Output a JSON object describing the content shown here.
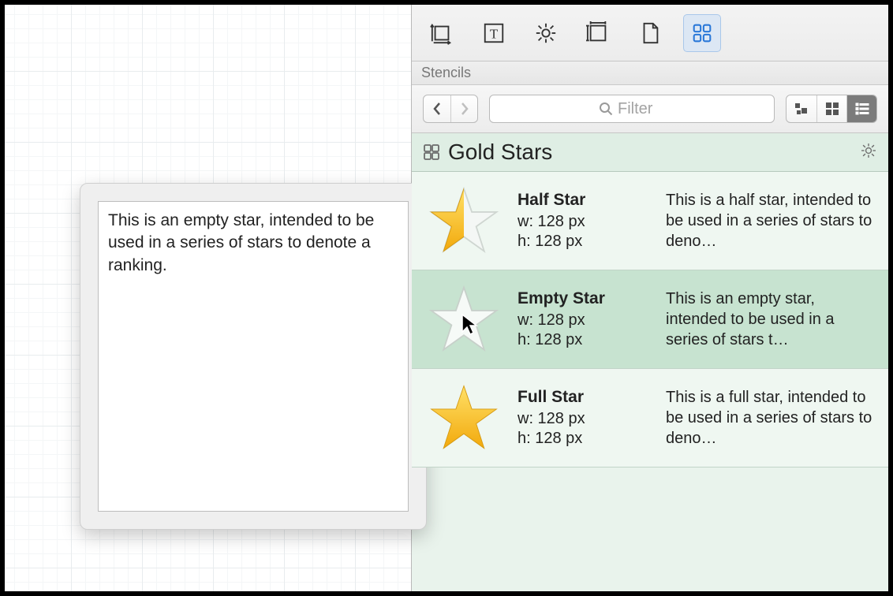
{
  "section_label": "Stencils",
  "filter": {
    "placeholder": "Filter"
  },
  "stencil_set": {
    "title": "Gold Stars"
  },
  "popover": {
    "text": "This is an empty star, intended to be used in a series of stars to denote a ranking."
  },
  "items": [
    {
      "name": "Half Star",
      "w_label": "w: 128 px",
      "h_label": "h: 128 px",
      "desc": "This is a half star, intended to be used in a series of stars to deno…"
    },
    {
      "name": "Empty Star",
      "w_label": "w: 128 px",
      "h_label": "h: 128 px",
      "desc": "This is an empty star, intended to be used in a series of stars t…"
    },
    {
      "name": "Full Star",
      "w_label": "w: 128 px",
      "h_label": "h: 128 px",
      "desc": "This is a full star, intended to be used in a series of stars to deno…"
    }
  ]
}
